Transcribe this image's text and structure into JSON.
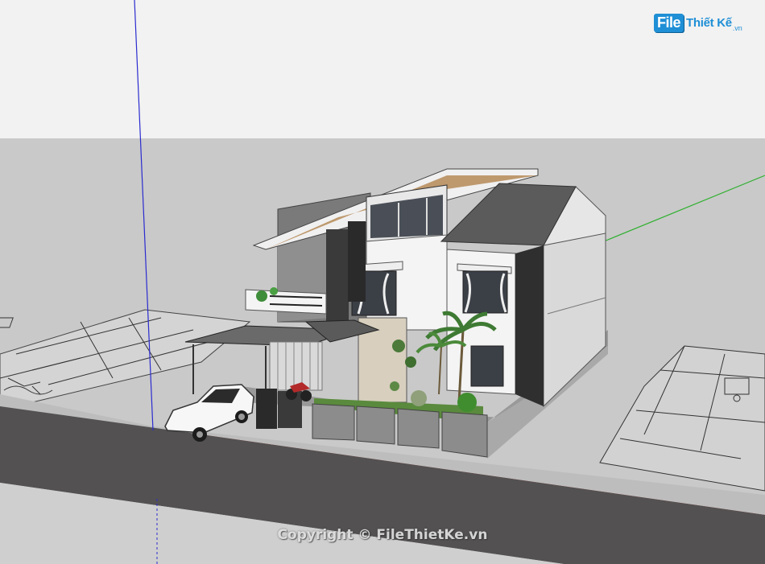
{
  "watermark": {
    "logo_mark": "File",
    "logo_text": "Thiết Kế",
    "logo_suffix": ".vn",
    "copyright": "Copyright © FileThietKe.vn"
  },
  "colors": {
    "sky": "#f2f2f2",
    "ground": "#c8c8c8",
    "road": "#555353",
    "sidewalk": "#bdbdbd",
    "axis_red": "#c33a3a",
    "axis_green": "#2fb02f",
    "axis_blue": "#2b2bd0",
    "roof_dark": "#5b5b5b",
    "wall_white": "#f4f4f4",
    "stone": "#8c8c8c",
    "wood": "#b58a57"
  },
  "scene": {
    "subject": "two-storey-modern-house-3d-model",
    "icons": [
      "car-icon",
      "motorbike-icon",
      "tree-icon"
    ]
  }
}
